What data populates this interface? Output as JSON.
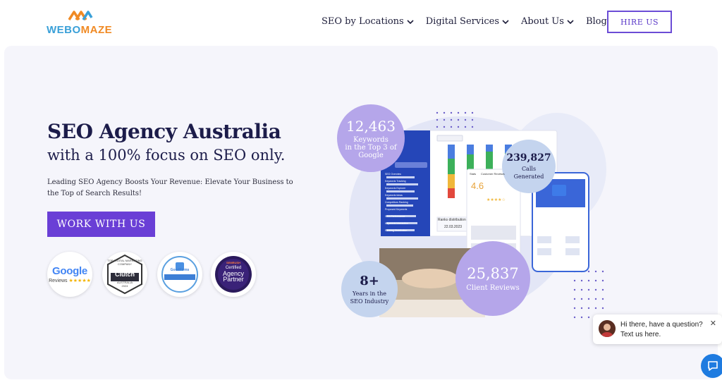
{
  "header": {
    "logo_text_a": "WEBO",
    "logo_text_b": "MAZE",
    "nav": [
      {
        "label": "SEO by Locations",
        "has_menu": true
      },
      {
        "label": "Digital Services",
        "has_menu": true
      },
      {
        "label": "About Us",
        "has_menu": true
      },
      {
        "label": "Blog",
        "has_menu": false
      }
    ],
    "hire_label": "HIRE US"
  },
  "hero": {
    "title": "SEO Agency Australia",
    "subtitle": "with a 100% focus on SEO only.",
    "description": "Leading SEO Agency Boosts Your Revenue: Elevate Your Business to the Top of Search Results!",
    "cta_label": "WORK WITH US"
  },
  "badges": {
    "google": {
      "name": "Google",
      "sub": "Reviews"
    },
    "clutch": {
      "top": "TOP DIGITAL MARKETING COMPANY",
      "name": "Clutch",
      "sub": "AUSTRALIA",
      "year": "2024"
    },
    "goodfirms": {
      "name": "GoodFirms",
      "ribbon": "TOP DIGITAL SERVICE PROVIDER"
    },
    "semrush": {
      "top": "SEMRUSH",
      "l1": "Certified",
      "l2": "Agency",
      "l3": "Partner"
    }
  },
  "stats": [
    {
      "num": "12,463",
      "label_1": "Keywords",
      "label_2": "in the Top 3 of",
      "label_3": "Google"
    },
    {
      "num": "239,827",
      "label_1": "Calls",
      "label_2": "Generated"
    },
    {
      "num": "8+",
      "label_1": "Years in the",
      "label_2": "SEO Industry"
    },
    {
      "num": "25,837",
      "label_1": "Client Reviews"
    }
  ],
  "dashboard": {
    "rating": "4.6",
    "ranks_label": "Ranks distribution",
    "date": "22.03.2023",
    "tab_a": "Stats",
    "tab_b": "Customer Reviews",
    "menu": [
      "SEO Overview",
      "Keywords Tracking",
      "Keywords Explorer",
      "Keywords Ideas",
      "Competitors Ranking",
      "Proposed Keywords",
      "SEO Performance",
      "Keywords Interaction",
      "Ranking Distribution"
    ]
  },
  "chat": {
    "line_1": "Hi there, have a question?",
    "line_2": "Text us here.",
    "close": "✕"
  },
  "colors": {
    "brand_purple": "#6a3fd6",
    "stat_purple": "#b6a6ea",
    "stat_blue": "#c4d4ee",
    "navy": "#1c1c4a"
  }
}
